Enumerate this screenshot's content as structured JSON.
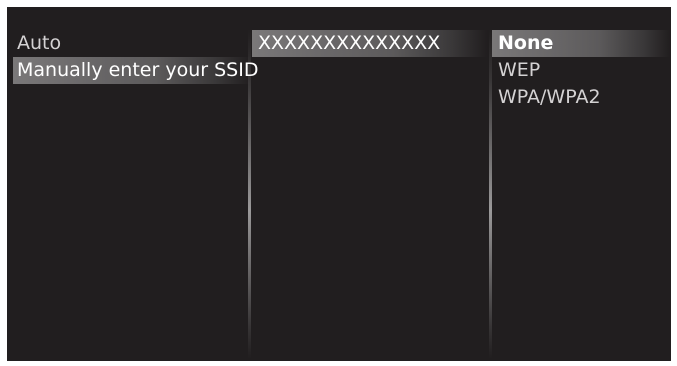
{
  "menu": {
    "items": [
      {
        "label": "Auto",
        "selected": false
      },
      {
        "label": "Manually enter your SSID",
        "selected": true
      }
    ]
  },
  "ssid": {
    "value": "XXXXXXXXXXXXXX"
  },
  "security": {
    "options": [
      {
        "label": "None",
        "selected": true
      },
      {
        "label": "WEP",
        "selected": false
      },
      {
        "label": "WPA/WPA2",
        "selected": false
      }
    ]
  },
  "colors": {
    "background": "#211e1f",
    "text": "#d4d2d3",
    "highlight": "#7a7879"
  }
}
